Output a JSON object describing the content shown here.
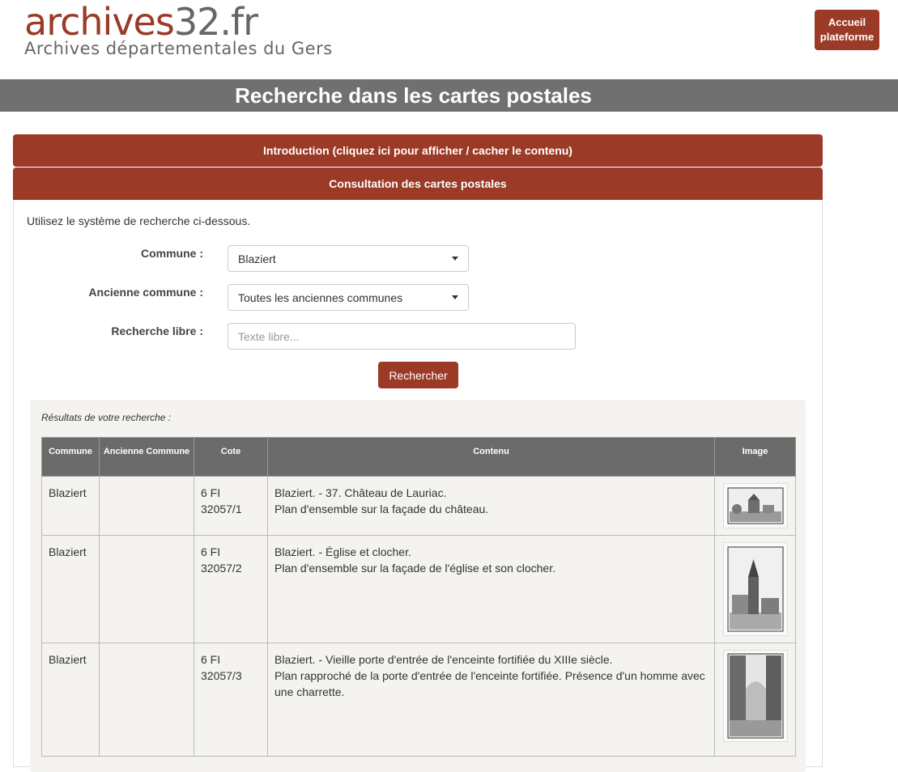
{
  "header": {
    "logo_main_a": "archives",
    "logo_main_b": "32.fr",
    "logo_sub": "Archives départementales du Gers",
    "home_button": "Accueil plateforme"
  },
  "page_title": "Recherche dans les cartes postales",
  "accordion": {
    "intro": "Introduction (cliquez ici pour afficher / cacher le contenu)",
    "consult": "Consultation des cartes postales"
  },
  "form": {
    "intro_text": "Utilisez le système de recherche ci-dessous.",
    "commune_label": "Commune :",
    "commune_value": "Blaziert",
    "ancienne_label": "Ancienne commune :",
    "ancienne_value": "Toutes les anciennes communes",
    "libre_label": "Recherche libre :",
    "libre_placeholder": "Texte libre...",
    "search_button": "Rechercher"
  },
  "results": {
    "title": "Résultats de votre recherche :",
    "headers": {
      "commune": "Commune",
      "ancienne": "Ancienne Commune",
      "cote": "Cote",
      "contenu": "Contenu",
      "image": "Image"
    },
    "rows": [
      {
        "commune": "Blaziert",
        "ancienne": "",
        "cote_a": "6 FI",
        "cote_b": "32057/1",
        "titre": "Blaziert. - 37. Château de Lauriac.",
        "desc": "Plan d'ensemble sur la façade du château.",
        "image_icon": "postcard-thumbnail-landscape"
      },
      {
        "commune": "Blaziert",
        "ancienne": "",
        "cote_a": "6 FI",
        "cote_b": "32057/2",
        "titre": "Blaziert. - Église et clocher.",
        "desc": "Plan d'ensemble sur la façade de l'église et son clocher.",
        "image_icon": "postcard-thumbnail-portrait"
      },
      {
        "commune": "Blaziert",
        "ancienne": "",
        "cote_a": "6 FI",
        "cote_b": "32057/3",
        "titre": "Blaziert. - Vieille porte d'entrée de l'enceinte fortifiée du XIIIe siècle.",
        "desc": "Plan rapproché de la porte d'entrée de l'enceinte fortifiée. Présence d'un homme avec une charrette.",
        "image_icon": "postcard-thumbnail-portrait"
      }
    ]
  },
  "colors": {
    "brand": "#9b3a26",
    "title_bar": "#707070",
    "table_header": "#6b6b6b"
  }
}
